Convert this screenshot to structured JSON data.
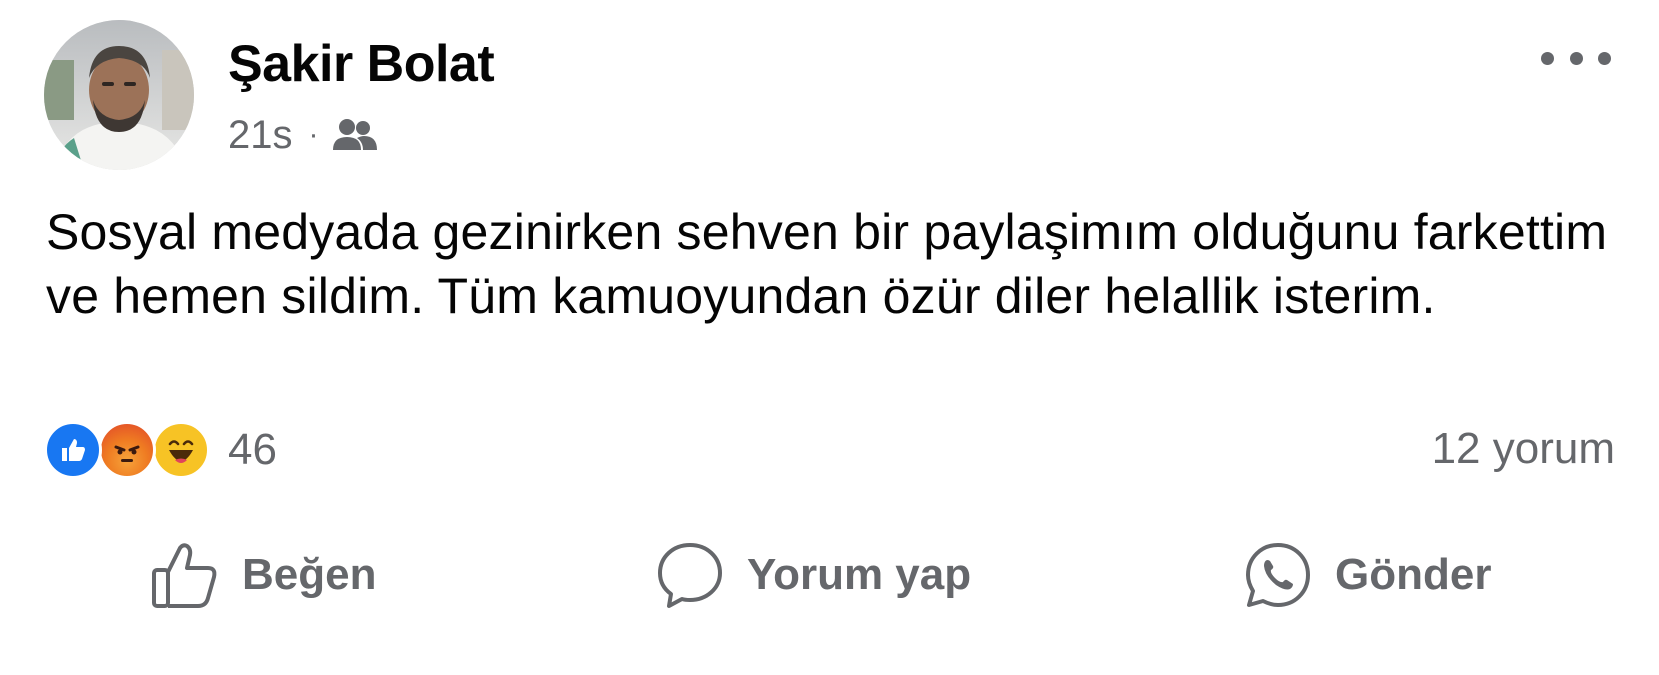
{
  "post": {
    "author": {
      "name": "Şakir Bolat",
      "avatar_icon": "profile-photo"
    },
    "meta": {
      "time": "21s",
      "separator": "·",
      "audience_icon": "friends-icon"
    },
    "more_icon": "more-options-icon",
    "text": "Sosyal medyada gezinirken sehven bir paylaşimım olduğunu farkettim ve hemen sildim. Tüm kamuoyundan özür diler helallik isterim.",
    "reactions": {
      "types": [
        "like",
        "angry",
        "haha"
      ],
      "count": "46"
    },
    "comments": {
      "label": "12 yorum"
    },
    "actions": {
      "like_label": "Beğen",
      "comment_label": "Yorum yap",
      "send_label": "Gönder"
    }
  },
  "colors": {
    "text_primary": "#050505",
    "text_secondary": "#65676b",
    "like_blue": "#1877f2",
    "angry_red": "#e9710f",
    "haha_yellow": "#f7b125"
  }
}
